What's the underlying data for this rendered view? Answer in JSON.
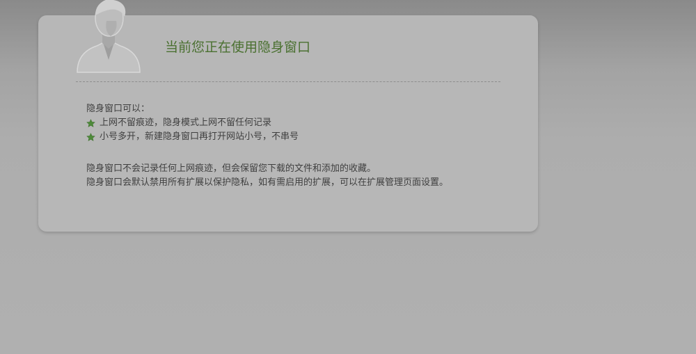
{
  "panel": {
    "title": "当前您正在使用隐身窗口",
    "intro": "隐身窗口可以：",
    "features": [
      "上网不留痕迹，隐身模式上网不留任何记录",
      "小号多开，新建隐身窗口再打开网站小号，不串号"
    ],
    "notes": [
      "隐身窗口不会记录任何上网痕迹，但会保留您下载的文件和添加的收藏。",
      "隐身窗口会默认禁用所有扩展以保护隐私，如有需启用的扩展，可以在扩展管理页面设置。"
    ]
  },
  "icons": {
    "avatar": "incognito-person-silhouette-icon",
    "bullet": "green-star-icon"
  },
  "colors": {
    "title": "#4a7030",
    "bullet_star": "#4e8a3a",
    "panel_bg": "#b7b7b7"
  }
}
